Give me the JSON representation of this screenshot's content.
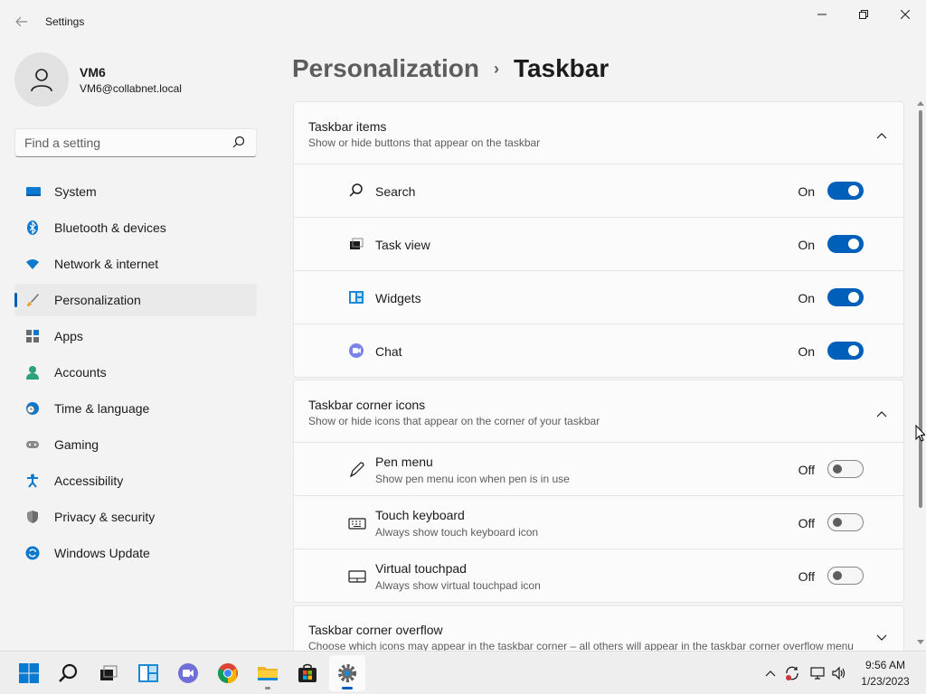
{
  "window": {
    "app_title": "Settings",
    "back_icon": "back-arrow-icon",
    "controls": [
      "minimize-icon",
      "maximize-icon",
      "close-icon"
    ]
  },
  "account": {
    "name": "VM6",
    "email": "VM6@collabnet.local"
  },
  "search": {
    "placeholder": "Find a setting"
  },
  "sidebar": {
    "items": [
      {
        "label": "System",
        "icon": "system-icon",
        "active": false
      },
      {
        "label": "Bluetooth & devices",
        "icon": "bluetooth-icon",
        "active": false
      },
      {
        "label": "Network & internet",
        "icon": "wifi-icon",
        "active": false
      },
      {
        "label": "Personalization",
        "icon": "brush-icon",
        "active": true
      },
      {
        "label": "Apps",
        "icon": "apps-icon",
        "active": false
      },
      {
        "label": "Accounts",
        "icon": "person-icon",
        "active": false
      },
      {
        "label": "Time & language",
        "icon": "clock-globe-icon",
        "active": false
      },
      {
        "label": "Gaming",
        "icon": "gamepad-icon",
        "active": false
      },
      {
        "label": "Accessibility",
        "icon": "accessibility-icon",
        "active": false
      },
      {
        "label": "Privacy & security",
        "icon": "shield-icon",
        "active": false
      },
      {
        "label": "Windows Update",
        "icon": "update-icon",
        "active": false
      }
    ]
  },
  "breadcrumb": {
    "parent": "Personalization",
    "separator": "›",
    "current": "Taskbar"
  },
  "sections": [
    {
      "title": "Taskbar items",
      "subtitle": "Show or hide buttons that appear on the taskbar",
      "expanded": true,
      "rows": [
        {
          "label": "Search",
          "state": "On",
          "on": true,
          "icon": "search-icon"
        },
        {
          "label": "Task view",
          "state": "On",
          "on": true,
          "icon": "task-view-icon"
        },
        {
          "label": "Widgets",
          "state": "On",
          "on": true,
          "icon": "widgets-icon"
        },
        {
          "label": "Chat",
          "state": "On",
          "on": true,
          "icon": "chat-icon"
        }
      ]
    },
    {
      "title": "Taskbar corner icons",
      "subtitle": "Show or hide icons that appear on the corner of your taskbar",
      "expanded": true,
      "rows": [
        {
          "label": "Pen menu",
          "sub": "Show pen menu icon when pen is in use",
          "state": "Off",
          "on": false,
          "icon": "pen-icon"
        },
        {
          "label": "Touch keyboard",
          "sub": "Always show touch keyboard icon",
          "state": "Off",
          "on": false,
          "icon": "keyboard-icon"
        },
        {
          "label": "Virtual touchpad",
          "sub": "Always show virtual touchpad icon",
          "state": "Off",
          "on": false,
          "icon": "touchpad-icon"
        }
      ]
    },
    {
      "title": "Taskbar corner overflow",
      "subtitle": "Choose which icons may appear in the taskbar corner – all others will appear in the taskbar corner overflow menu",
      "expanded": false
    }
  ],
  "taskbar": {
    "apps": [
      "start-icon",
      "search-icon",
      "task-view-icon",
      "widgets-icon",
      "chat-icon",
      "chrome-icon",
      "file-explorer-icon",
      "store-icon",
      "settings-icon"
    ],
    "tray": [
      "chevron-up-icon",
      "sync-icon",
      "network-icon",
      "volume-icon"
    ],
    "time": "9:56 AM",
    "date": "1/23/2023"
  },
  "colors": {
    "accent": "#005fb8",
    "background": "#f3f3f3",
    "card": "#fbfbfb"
  }
}
